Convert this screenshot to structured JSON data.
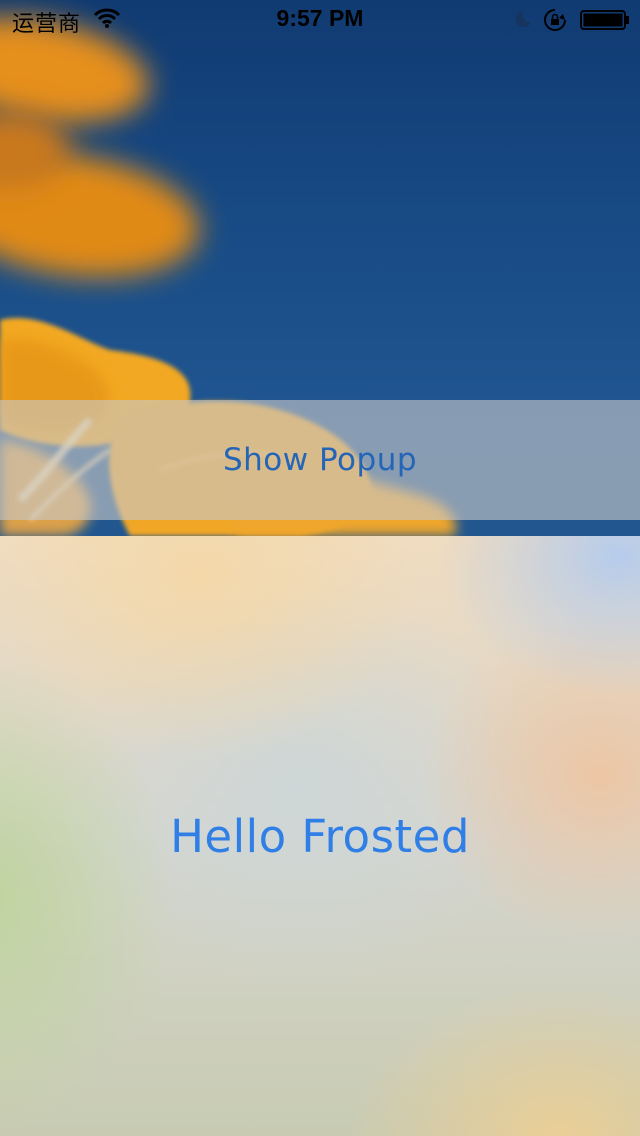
{
  "status_bar": {
    "carrier": "运营商",
    "time": "9:57 PM",
    "icons": [
      "wifi-icon",
      "moon-icon",
      "rotation-lock-icon",
      "battery-icon"
    ]
  },
  "popup_bar": {
    "label": "Show Popup"
  },
  "frosted_panel": {
    "text": "Hello Frosted"
  },
  "colors": {
    "accent": "#2f7fe6",
    "popup_label": "#2565b8",
    "sky": "#1c4a80",
    "flower": "#f0a020"
  }
}
